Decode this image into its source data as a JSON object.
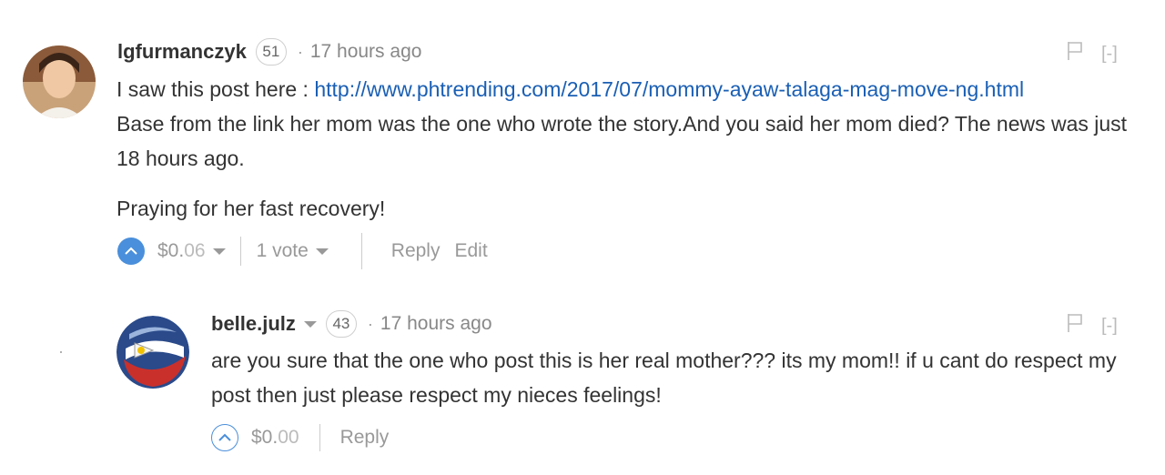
{
  "comments": [
    {
      "author": "lgfurmanczyk",
      "reputation": "51",
      "separator": "·",
      "time": "17 hours ago",
      "line1_prefix": "I saw this post here : ",
      "link": "http://www.phtrending.com/2017/07/mommy-ayaw-talaga-mag-move-ng.html",
      "paragraph1_rest": "Base from the link her mom was the one who wrote the story.And you said her mom died? The news was just 18 hours ago.",
      "paragraph2": "Praying for her fast recovery!",
      "payout_main": "$0.",
      "payout_cents": "06",
      "votes": "1 vote",
      "reply": "Reply",
      "edit": "Edit",
      "collapse": "[-]"
    },
    {
      "author": "belle.julz",
      "reputation": "43",
      "separator": "·",
      "time": "17 hours ago",
      "text": "are you sure that the one who post this is her real mother??? its my mom!! if u cant do respect my post then just please respect my nieces feelings!",
      "payout_main": "$0.",
      "payout_cents": "00",
      "reply": "Reply",
      "collapse": "[-]"
    }
  ],
  "colors": {
    "accent": "#4a8fdb",
    "link": "#1a5fb4",
    "muted": "#999999"
  },
  "icons": [
    "flag-icon",
    "upvote-chevron-icon",
    "caret-down-icon"
  ]
}
